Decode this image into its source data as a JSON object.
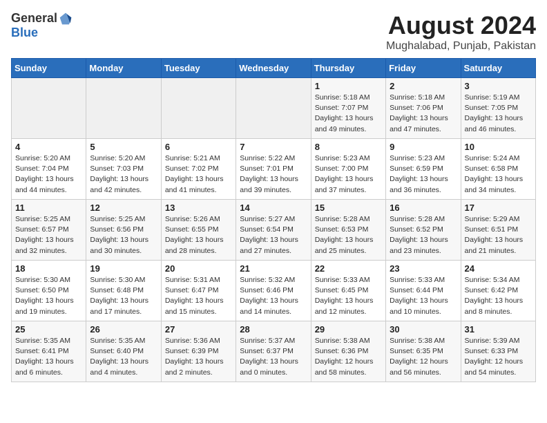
{
  "header": {
    "logo_general": "General",
    "logo_blue": "Blue",
    "month": "August 2024",
    "location": "Mughalabad, Punjab, Pakistan"
  },
  "weekdays": [
    "Sunday",
    "Monday",
    "Tuesday",
    "Wednesday",
    "Thursday",
    "Friday",
    "Saturday"
  ],
  "weeks": [
    [
      {
        "day": "",
        "sunrise": "",
        "sunset": "",
        "daylight": ""
      },
      {
        "day": "",
        "sunrise": "",
        "sunset": "",
        "daylight": ""
      },
      {
        "day": "",
        "sunrise": "",
        "sunset": "",
        "daylight": ""
      },
      {
        "day": "",
        "sunrise": "",
        "sunset": "",
        "daylight": ""
      },
      {
        "day": "1",
        "sunrise": "Sunrise: 5:18 AM",
        "sunset": "Sunset: 7:07 PM",
        "daylight": "Daylight: 13 hours and 49 minutes."
      },
      {
        "day": "2",
        "sunrise": "Sunrise: 5:18 AM",
        "sunset": "Sunset: 7:06 PM",
        "daylight": "Daylight: 13 hours and 47 minutes."
      },
      {
        "day": "3",
        "sunrise": "Sunrise: 5:19 AM",
        "sunset": "Sunset: 7:05 PM",
        "daylight": "Daylight: 13 hours and 46 minutes."
      }
    ],
    [
      {
        "day": "4",
        "sunrise": "Sunrise: 5:20 AM",
        "sunset": "Sunset: 7:04 PM",
        "daylight": "Daylight: 13 hours and 44 minutes."
      },
      {
        "day": "5",
        "sunrise": "Sunrise: 5:20 AM",
        "sunset": "Sunset: 7:03 PM",
        "daylight": "Daylight: 13 hours and 42 minutes."
      },
      {
        "day": "6",
        "sunrise": "Sunrise: 5:21 AM",
        "sunset": "Sunset: 7:02 PM",
        "daylight": "Daylight: 13 hours and 41 minutes."
      },
      {
        "day": "7",
        "sunrise": "Sunrise: 5:22 AM",
        "sunset": "Sunset: 7:01 PM",
        "daylight": "Daylight: 13 hours and 39 minutes."
      },
      {
        "day": "8",
        "sunrise": "Sunrise: 5:23 AM",
        "sunset": "Sunset: 7:00 PM",
        "daylight": "Daylight: 13 hours and 37 minutes."
      },
      {
        "day": "9",
        "sunrise": "Sunrise: 5:23 AM",
        "sunset": "Sunset: 6:59 PM",
        "daylight": "Daylight: 13 hours and 36 minutes."
      },
      {
        "day": "10",
        "sunrise": "Sunrise: 5:24 AM",
        "sunset": "Sunset: 6:58 PM",
        "daylight": "Daylight: 13 hours and 34 minutes."
      }
    ],
    [
      {
        "day": "11",
        "sunrise": "Sunrise: 5:25 AM",
        "sunset": "Sunset: 6:57 PM",
        "daylight": "Daylight: 13 hours and 32 minutes."
      },
      {
        "day": "12",
        "sunrise": "Sunrise: 5:25 AM",
        "sunset": "Sunset: 6:56 PM",
        "daylight": "Daylight: 13 hours and 30 minutes."
      },
      {
        "day": "13",
        "sunrise": "Sunrise: 5:26 AM",
        "sunset": "Sunset: 6:55 PM",
        "daylight": "Daylight: 13 hours and 28 minutes."
      },
      {
        "day": "14",
        "sunrise": "Sunrise: 5:27 AM",
        "sunset": "Sunset: 6:54 PM",
        "daylight": "Daylight: 13 hours and 27 minutes."
      },
      {
        "day": "15",
        "sunrise": "Sunrise: 5:28 AM",
        "sunset": "Sunset: 6:53 PM",
        "daylight": "Daylight: 13 hours and 25 minutes."
      },
      {
        "day": "16",
        "sunrise": "Sunrise: 5:28 AM",
        "sunset": "Sunset: 6:52 PM",
        "daylight": "Daylight: 13 hours and 23 minutes."
      },
      {
        "day": "17",
        "sunrise": "Sunrise: 5:29 AM",
        "sunset": "Sunset: 6:51 PM",
        "daylight": "Daylight: 13 hours and 21 minutes."
      }
    ],
    [
      {
        "day": "18",
        "sunrise": "Sunrise: 5:30 AM",
        "sunset": "Sunset: 6:50 PM",
        "daylight": "Daylight: 13 hours and 19 minutes."
      },
      {
        "day": "19",
        "sunrise": "Sunrise: 5:30 AM",
        "sunset": "Sunset: 6:48 PM",
        "daylight": "Daylight: 13 hours and 17 minutes."
      },
      {
        "day": "20",
        "sunrise": "Sunrise: 5:31 AM",
        "sunset": "Sunset: 6:47 PM",
        "daylight": "Daylight: 13 hours and 15 minutes."
      },
      {
        "day": "21",
        "sunrise": "Sunrise: 5:32 AM",
        "sunset": "Sunset: 6:46 PM",
        "daylight": "Daylight: 13 hours and 14 minutes."
      },
      {
        "day": "22",
        "sunrise": "Sunrise: 5:33 AM",
        "sunset": "Sunset: 6:45 PM",
        "daylight": "Daylight: 13 hours and 12 minutes."
      },
      {
        "day": "23",
        "sunrise": "Sunrise: 5:33 AM",
        "sunset": "Sunset: 6:44 PM",
        "daylight": "Daylight: 13 hours and 10 minutes."
      },
      {
        "day": "24",
        "sunrise": "Sunrise: 5:34 AM",
        "sunset": "Sunset: 6:42 PM",
        "daylight": "Daylight: 13 hours and 8 minutes."
      }
    ],
    [
      {
        "day": "25",
        "sunrise": "Sunrise: 5:35 AM",
        "sunset": "Sunset: 6:41 PM",
        "daylight": "Daylight: 13 hours and 6 minutes."
      },
      {
        "day": "26",
        "sunrise": "Sunrise: 5:35 AM",
        "sunset": "Sunset: 6:40 PM",
        "daylight": "Daylight: 13 hours and 4 minutes."
      },
      {
        "day": "27",
        "sunrise": "Sunrise: 5:36 AM",
        "sunset": "Sunset: 6:39 PM",
        "daylight": "Daylight: 13 hours and 2 minutes."
      },
      {
        "day": "28",
        "sunrise": "Sunrise: 5:37 AM",
        "sunset": "Sunset: 6:37 PM",
        "daylight": "Daylight: 13 hours and 0 minutes."
      },
      {
        "day": "29",
        "sunrise": "Sunrise: 5:38 AM",
        "sunset": "Sunset: 6:36 PM",
        "daylight": "Daylight: 12 hours and 58 minutes."
      },
      {
        "day": "30",
        "sunrise": "Sunrise: 5:38 AM",
        "sunset": "Sunset: 6:35 PM",
        "daylight": "Daylight: 12 hours and 56 minutes."
      },
      {
        "day": "31",
        "sunrise": "Sunrise: 5:39 AM",
        "sunset": "Sunset: 6:33 PM",
        "daylight": "Daylight: 12 hours and 54 minutes."
      }
    ]
  ]
}
